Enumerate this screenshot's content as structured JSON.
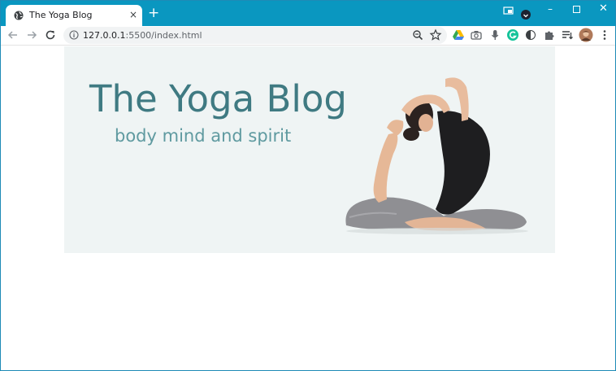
{
  "browser": {
    "tab_title": "The Yoga Blog",
    "tab_close": "×",
    "new_tab": "+",
    "url_host": "127.0.0.1",
    "url_path": ":5500/index.html",
    "window_controls": {
      "minimize": "–",
      "close": "✕"
    }
  },
  "page": {
    "banner_title": "The Yoga Blog",
    "banner_tagline": "body mind and spirit"
  },
  "colors": {
    "chrome_frame": "#0a97c0",
    "banner_background": "#eff4f4",
    "title_color": "#3f7a82",
    "tagline_color": "#5f9aa0"
  }
}
